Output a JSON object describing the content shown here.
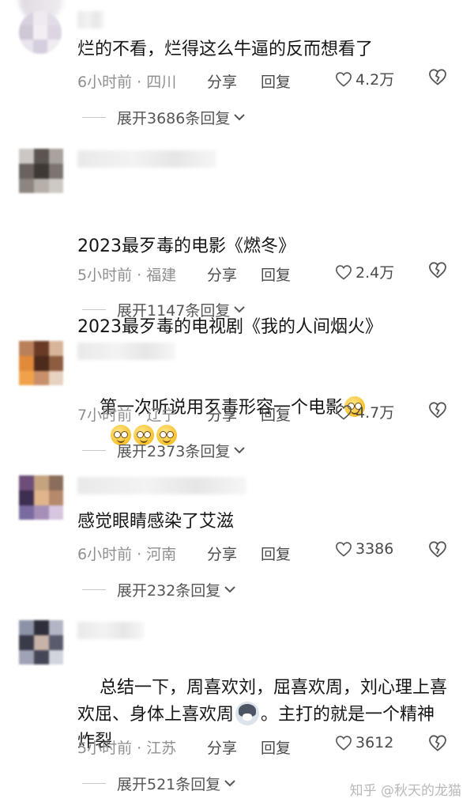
{
  "comments": [
    {
      "text": "烂的不看，烂得这么牛逼的反而想看了",
      "time": "6小时前",
      "location": "四川",
      "share": "分享",
      "reply": "回复",
      "likes": "4.2万",
      "expand": "展开3686条回复"
    },
    {
      "line1": "2023最歹毒的电影《燃冬》",
      "line2": "2023最歹毒的电视剧《我的人间烟火》",
      "time": "5小时前",
      "location": "福建",
      "share": "分享",
      "reply": "回复",
      "likes": "2.4万",
      "expand": "展开1147条回复"
    },
    {
      "text": "第一次听说用歹毒形容一个电影",
      "time": "7小时前",
      "location": "辽宁",
      "share": "分享",
      "reply": "回复",
      "likes": "4.7万",
      "expand": "展开2373条回复"
    },
    {
      "text": "感觉眼睛感染了艾滋",
      "time": "6小时前",
      "location": "河南",
      "share": "分享",
      "reply": "回复",
      "likes": "3386",
      "expand": "展开232条回复"
    },
    {
      "text_a": "总结一下，周喜欢刘，屈喜欢周，刘心理上喜欢屈、身体上喜欢周",
      "text_b": "。主打的就是一个精神炸裂",
      "time": "5小时前",
      "location": "江苏",
      "share": "分享",
      "reply": "回复",
      "likes": "3612",
      "expand": "展开521条回复"
    }
  ],
  "separator": " · ",
  "watermark": "知乎 @秋天的龙猫",
  "icons": {
    "like": "heart-outline-icon",
    "dislike": "broken-heart-outline-icon",
    "expand": "chevron-down-icon"
  },
  "colors": {
    "text": "#151515",
    "meta": "#8f8f8f",
    "action": "#4a4a4a"
  }
}
